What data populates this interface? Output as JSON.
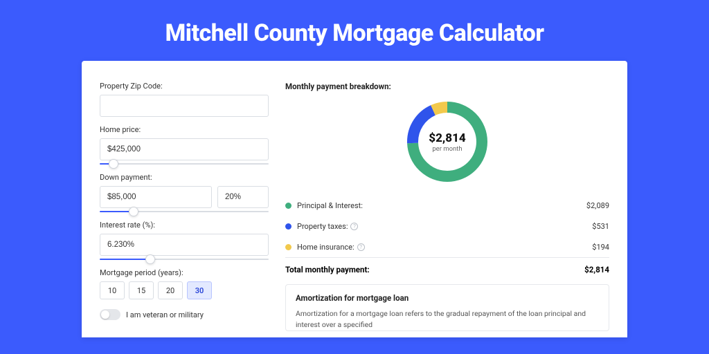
{
  "title": "Mitchell County Mortgage Calculator",
  "form": {
    "zip": {
      "label": "Property Zip Code:",
      "value": ""
    },
    "home_price": {
      "label": "Home price:",
      "value": "$425,000",
      "slider_pct": 8
    },
    "down_payment": {
      "label": "Down payment:",
      "amount": "$85,000",
      "pct": "20%",
      "slider_pct": 20
    },
    "interest": {
      "label": "Interest rate (%):",
      "value": "6.230%",
      "slider_pct": 30
    },
    "period": {
      "label": "Mortgage period (years):",
      "options": [
        "10",
        "15",
        "20",
        "30"
      ],
      "active_index": 3
    },
    "veteran": {
      "label": "I am veteran or military",
      "on": false
    }
  },
  "breakdown": {
    "title": "Monthly payment breakdown:",
    "total": "$2,814",
    "per": "per month",
    "items": [
      {
        "label": "Principal & Interest:",
        "value": "$2,089",
        "color": "#3fae7e",
        "info": false
      },
      {
        "label": "Property taxes:",
        "value": "$531",
        "color": "#2f54eb",
        "info": true
      },
      {
        "label": "Home insurance:",
        "value": "$194",
        "color": "#f2c94c",
        "info": true
      }
    ],
    "total_row": {
      "label": "Total monthly payment:",
      "value": "$2,814"
    }
  },
  "chart_data": {
    "type": "pie",
    "title": "Monthly payment breakdown",
    "series": [
      {
        "name": "Principal & Interest",
        "value": 2089,
        "color": "#3fae7e"
      },
      {
        "name": "Property taxes",
        "value": 531,
        "color": "#2f54eb"
      },
      {
        "name": "Home insurance",
        "value": 194,
        "color": "#f2c94c"
      }
    ],
    "total": 2814,
    "unit": "USD per month"
  },
  "amort": {
    "title": "Amortization for mortgage loan",
    "text": "Amortization for a mortgage loan refers to the gradual repayment of the loan principal and interest over a specified"
  }
}
